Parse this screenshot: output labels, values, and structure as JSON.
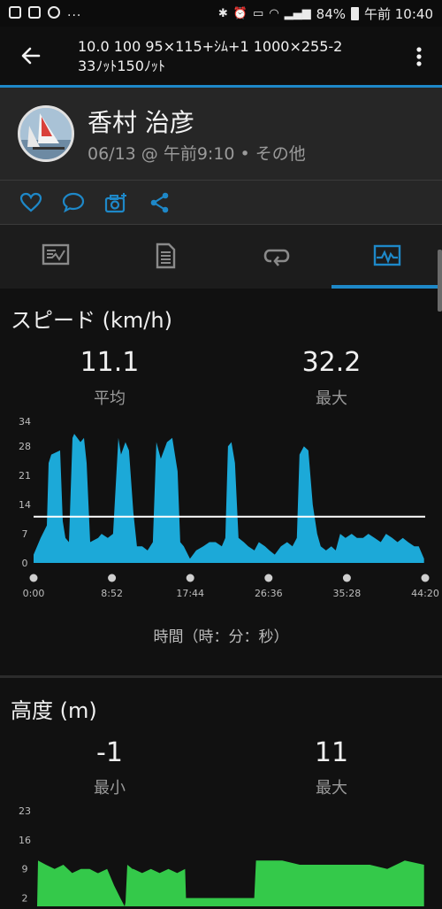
{
  "status_bar": {
    "left_more": "...",
    "battery": "84%",
    "time": "午前 10:40"
  },
  "header": {
    "title_line1": "10.0 100 95×115+ｼﾑ+1 1000×255-2",
    "title_line2": "33ﾉｯﾄ150ﾉｯﾄ"
  },
  "profile": {
    "name": "香村 治彦",
    "meta": "06/13 @ 午前9:10 • その他"
  },
  "actions": [
    "heart-icon",
    "comment-icon",
    "camera-add-icon",
    "share-icon"
  ],
  "tabs": [
    "overview-tab",
    "details-tab",
    "laps-tab",
    "charts-tab"
  ],
  "active_tab_index": 3,
  "colors": {
    "accent": "#1e88c8",
    "speed_fill": "#1ca9d8",
    "altitude_fill": "#34c94a",
    "avg_line": "#ffffff"
  },
  "speed_section": {
    "title": "スピード (km/h)",
    "avg_value": "11.1",
    "avg_label": "平均",
    "max_value": "32.2",
    "max_label": "最大",
    "x_axis_title": "時間（時：分：秒）"
  },
  "altitude_section": {
    "title": "高度 (m)",
    "min_value": "-1",
    "min_label": "最小",
    "max_value": "11",
    "max_label": "最大"
  },
  "chart_data": [
    {
      "type": "area",
      "ylim": [
        0,
        34
      ],
      "yticks": [
        "34",
        "28",
        "21",
        "14",
        "7",
        "0"
      ],
      "ytick_values": [
        34,
        28,
        21,
        14,
        7,
        0
      ],
      "xticks": [
        "0:00",
        "8:52",
        "17:44",
        "26:36",
        "35:28",
        "44:20"
      ],
      "xlim_minutes": [
        0,
        44.33
      ],
      "average_line": 11.1,
      "x": [
        0,
        0.8,
        1.5,
        1.7,
        2.0,
        3.0,
        3.3,
        3.6,
        4.0,
        4.4,
        4.6,
        5.3,
        5.7,
        6.0,
        6.4,
        7.3,
        7.7,
        8.4,
        9.0,
        9.6,
        9.9,
        10.4,
        10.8,
        11.3,
        11.7,
        12.3,
        12.9,
        13.5,
        13.9,
        14.4,
        15.1,
        15.7,
        16.3,
        16.6,
        17.0,
        17.7,
        18.4,
        19.2,
        19.9,
        20.6,
        21.3,
        21.7,
        22.0,
        22.4,
        22.8,
        23.2,
        23.8,
        24.3,
        25.0,
        25.5,
        26.2,
        26.7,
        27.3,
        28.0,
        28.7,
        29.3,
        29.8,
        30.1,
        30.6,
        31.1,
        31.6,
        32.1,
        32.5,
        33.1,
        33.7,
        34.2,
        34.7,
        35.3,
        36.0,
        36.6,
        37.3,
        37.9,
        38.6,
        39.3,
        39.9,
        40.6,
        41.2,
        41.8,
        42.4,
        43.1,
        43.6,
        44.2
      ],
      "y": [
        2,
        6,
        9,
        24,
        26,
        27,
        10,
        6,
        5,
        30,
        31,
        29,
        30,
        24,
        5,
        6,
        7,
        6,
        7,
        30,
        26,
        29,
        27,
        12,
        4,
        4,
        3,
        5,
        29,
        25,
        29,
        30,
        22,
        5,
        4,
        1,
        3,
        4,
        5,
        5,
        4,
        6,
        28,
        29,
        24,
        6,
        5,
        4,
        3,
        5,
        4,
        3,
        2,
        4,
        5,
        4,
        6,
        26,
        28,
        27,
        14,
        7,
        4,
        3,
        4,
        3,
        7,
        6,
        7,
        6,
        6,
        7,
        6,
        5,
        7,
        6,
        5,
        6,
        5,
        4,
        4,
        1
      ]
    },
    {
      "type": "area",
      "ylim": [
        0,
        23
      ],
      "yticks": [
        "23",
        "16",
        "9",
        "2"
      ],
      "ytick_values": [
        23,
        16,
        9,
        2
      ],
      "xlim_minutes": [
        0,
        44.33
      ],
      "x": [
        0,
        0.1,
        1.0,
        2.0,
        3.0,
        4.0,
        5.0,
        6.0,
        6.9,
        7.0,
        8.0,
        8.8,
        9.5,
        10.0,
        10.1,
        10.3,
        10.9,
        11.0,
        12.0,
        13.0,
        14.0,
        15.0,
        16.0,
        16.9,
        17.0,
        20.0,
        24.0,
        24.8,
        25.0,
        26.0,
        28.0,
        30.0,
        32.0,
        34.0,
        36.0,
        38.0,
        40.0,
        42.0,
        44.2
      ],
      "y": [
        0,
        11,
        10,
        9,
        10,
        8,
        9,
        9,
        8,
        8,
        9,
        5,
        2,
        0,
        1,
        10,
        9,
        9,
        8,
        9,
        8,
        9,
        8,
        9,
        2,
        2,
        2,
        2,
        11,
        11,
        11,
        10,
        10,
        10,
        10,
        10,
        9,
        11,
        10
      ]
    }
  ]
}
